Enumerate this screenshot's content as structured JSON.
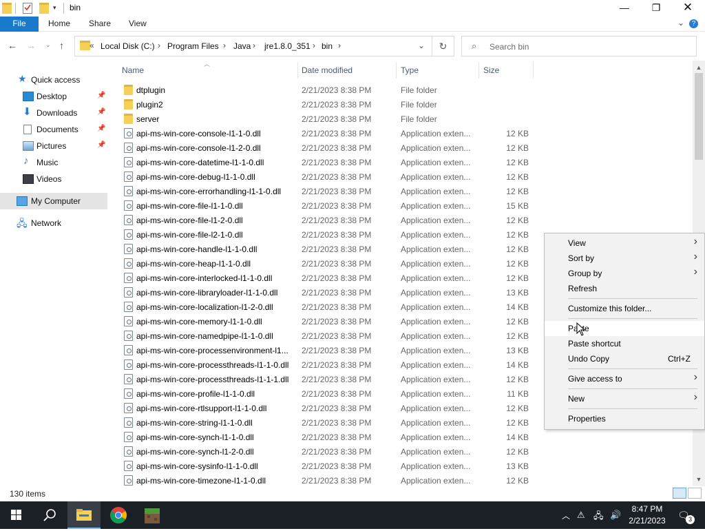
{
  "window": {
    "title": "bin"
  },
  "ribbon": {
    "tabs": [
      "File",
      "Home",
      "Share",
      "View"
    ],
    "help": "?"
  },
  "address": {
    "overflow": "«",
    "crumbs": [
      "Local Disk (C:)",
      "Program Files",
      "Java",
      "jre1.8.0_351",
      "bin"
    ]
  },
  "search": {
    "placeholder": "Search bin"
  },
  "sidebar": {
    "items": [
      {
        "label": "Quick access",
        "icon": "star-icon"
      },
      {
        "label": "Desktop",
        "icon": "desktop-icon",
        "pinned": true
      },
      {
        "label": "Downloads",
        "icon": "download-icon",
        "pinned": true
      },
      {
        "label": "Documents",
        "icon": "documents-icon",
        "pinned": true
      },
      {
        "label": "Pictures",
        "icon": "pictures-icon",
        "pinned": true
      },
      {
        "label": "Music",
        "icon": "music-icon"
      },
      {
        "label": "Videos",
        "icon": "videos-icon"
      },
      {
        "label": "My Computer",
        "icon": "computer-icon",
        "selected": true
      },
      {
        "label": "Network",
        "icon": "network-icon"
      }
    ]
  },
  "columns": {
    "name": "Name",
    "date": "Date modified",
    "type": "Type",
    "size": "Size"
  },
  "files": [
    {
      "name": "dtplugin",
      "date": "2/21/2023 8:38 PM",
      "type": "File folder",
      "size": "",
      "kind": "folder"
    },
    {
      "name": "plugin2",
      "date": "2/21/2023 8:38 PM",
      "type": "File folder",
      "size": "",
      "kind": "folder"
    },
    {
      "name": "server",
      "date": "2/21/2023 8:38 PM",
      "type": "File folder",
      "size": "",
      "kind": "folder"
    },
    {
      "name": "api-ms-win-core-console-l1-1-0.dll",
      "date": "2/21/2023 8:38 PM",
      "type": "Application exten...",
      "size": "12 KB",
      "kind": "dll"
    },
    {
      "name": "api-ms-win-core-console-l1-2-0.dll",
      "date": "2/21/2023 8:38 PM",
      "type": "Application exten...",
      "size": "12 KB",
      "kind": "dll"
    },
    {
      "name": "api-ms-win-core-datetime-l1-1-0.dll",
      "date": "2/21/2023 8:38 PM",
      "type": "Application exten...",
      "size": "12 KB",
      "kind": "dll"
    },
    {
      "name": "api-ms-win-core-debug-l1-1-0.dll",
      "date": "2/21/2023 8:38 PM",
      "type": "Application exten...",
      "size": "12 KB",
      "kind": "dll"
    },
    {
      "name": "api-ms-win-core-errorhandling-l1-1-0.dll",
      "date": "2/21/2023 8:38 PM",
      "type": "Application exten...",
      "size": "12 KB",
      "kind": "dll"
    },
    {
      "name": "api-ms-win-core-file-l1-1-0.dll",
      "date": "2/21/2023 8:38 PM",
      "type": "Application exten...",
      "size": "15 KB",
      "kind": "dll"
    },
    {
      "name": "api-ms-win-core-file-l1-2-0.dll",
      "date": "2/21/2023 8:38 PM",
      "type": "Application exten...",
      "size": "12 KB",
      "kind": "dll"
    },
    {
      "name": "api-ms-win-core-file-l2-1-0.dll",
      "date": "2/21/2023 8:38 PM",
      "type": "Application exten...",
      "size": "12 KB",
      "kind": "dll"
    },
    {
      "name": "api-ms-win-core-handle-l1-1-0.dll",
      "date": "2/21/2023 8:38 PM",
      "type": "Application exten...",
      "size": "12 KB",
      "kind": "dll"
    },
    {
      "name": "api-ms-win-core-heap-l1-1-0.dll",
      "date": "2/21/2023 8:38 PM",
      "type": "Application exten...",
      "size": "12 KB",
      "kind": "dll"
    },
    {
      "name": "api-ms-win-core-interlocked-l1-1-0.dll",
      "date": "2/21/2023 8:38 PM",
      "type": "Application exten...",
      "size": "12 KB",
      "kind": "dll"
    },
    {
      "name": "api-ms-win-core-libraryloader-l1-1-0.dll",
      "date": "2/21/2023 8:38 PM",
      "type": "Application exten...",
      "size": "13 KB",
      "kind": "dll"
    },
    {
      "name": "api-ms-win-core-localization-l1-2-0.dll",
      "date": "2/21/2023 8:38 PM",
      "type": "Application exten...",
      "size": "14 KB",
      "kind": "dll"
    },
    {
      "name": "api-ms-win-core-memory-l1-1-0.dll",
      "date": "2/21/2023 8:38 PM",
      "type": "Application exten...",
      "size": "12 KB",
      "kind": "dll"
    },
    {
      "name": "api-ms-win-core-namedpipe-l1-1-0.dll",
      "date": "2/21/2023 8:38 PM",
      "type": "Application exten...",
      "size": "12 KB",
      "kind": "dll"
    },
    {
      "name": "api-ms-win-core-processenvironment-l1...",
      "date": "2/21/2023 8:38 PM",
      "type": "Application exten...",
      "size": "13 KB",
      "kind": "dll"
    },
    {
      "name": "api-ms-win-core-processthreads-l1-1-0.dll",
      "date": "2/21/2023 8:38 PM",
      "type": "Application exten...",
      "size": "14 KB",
      "kind": "dll"
    },
    {
      "name": "api-ms-win-core-processthreads-l1-1-1.dll",
      "date": "2/21/2023 8:38 PM",
      "type": "Application exten...",
      "size": "12 KB",
      "kind": "dll"
    },
    {
      "name": "api-ms-win-core-profile-l1-1-0.dll",
      "date": "2/21/2023 8:38 PM",
      "type": "Application exten...",
      "size": "11 KB",
      "kind": "dll"
    },
    {
      "name": "api-ms-win-core-rtlsupport-l1-1-0.dll",
      "date": "2/21/2023 8:38 PM",
      "type": "Application exten...",
      "size": "12 KB",
      "kind": "dll"
    },
    {
      "name": "api-ms-win-core-string-l1-1-0.dll",
      "date": "2/21/2023 8:38 PM",
      "type": "Application exten...",
      "size": "12 KB",
      "kind": "dll"
    },
    {
      "name": "api-ms-win-core-synch-l1-1-0.dll",
      "date": "2/21/2023 8:38 PM",
      "type": "Application exten...",
      "size": "14 KB",
      "kind": "dll"
    },
    {
      "name": "api-ms-win-core-synch-l1-2-0.dll",
      "date": "2/21/2023 8:38 PM",
      "type": "Application exten...",
      "size": "12 KB",
      "kind": "dll"
    },
    {
      "name": "api-ms-win-core-sysinfo-l1-1-0.dll",
      "date": "2/21/2023 8:38 PM",
      "type": "Application exten...",
      "size": "13 KB",
      "kind": "dll"
    },
    {
      "name": "api-ms-win-core-timezone-l1-1-0.dll",
      "date": "2/21/2023 8:38 PM",
      "type": "Application exten...",
      "size": "12 KB",
      "kind": "dll"
    }
  ],
  "status": {
    "item_count": "130 items"
  },
  "context_menu": {
    "items": [
      {
        "label": "View",
        "submenu": true
      },
      {
        "label": "Sort by",
        "submenu": true
      },
      {
        "label": "Group by",
        "submenu": true
      },
      {
        "label": "Refresh"
      },
      {
        "separator": true
      },
      {
        "label": "Customize this folder..."
      },
      {
        "separator": true
      },
      {
        "label": "Paste",
        "hover": true
      },
      {
        "label": "Paste shortcut"
      },
      {
        "label": "Undo Copy",
        "shortcut": "Ctrl+Z"
      },
      {
        "separator": true
      },
      {
        "label": "Give access to",
        "submenu": true
      },
      {
        "separator": true
      },
      {
        "label": "New",
        "submenu": true
      },
      {
        "separator": true
      },
      {
        "label": "Properties"
      }
    ]
  },
  "taskbar": {
    "apps": [
      "start-icon",
      "search-icon",
      "file-explorer-icon",
      "chrome-icon",
      "minecraft-icon"
    ],
    "time": "8:47 PM",
    "date": "2/21/2023",
    "notifications": "3"
  },
  "colors": {
    "accent": "#1979ca",
    "taskbar": "#1b1f26",
    "folder": "#f6cf57"
  }
}
